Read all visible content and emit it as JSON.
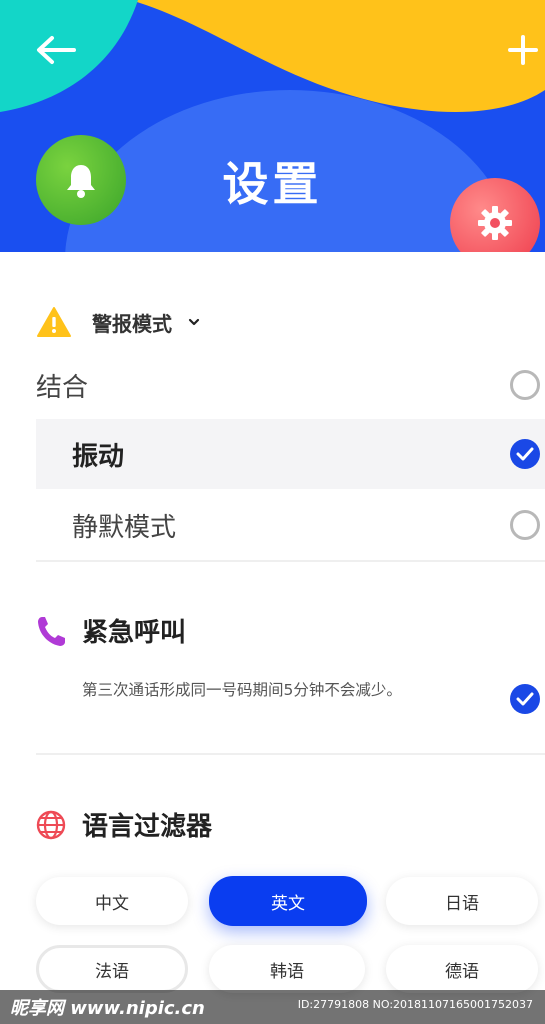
{
  "header": {
    "title": "设置",
    "back_icon": "arrow-left-icon",
    "add_icon": "plus-icon",
    "bell_icon": "bell-icon",
    "settings_icon": "gear-icon",
    "colors": {
      "teal": "#13d6c8",
      "yellow": "#ffc21a",
      "blue": "#1a4ff0",
      "green": "#4cb82f",
      "red": "#f25060"
    }
  },
  "alert_mode": {
    "icon": "warning-icon",
    "label": "警报模式",
    "dropdown_icon": "chevron-down-icon",
    "options": [
      {
        "label": "结合",
        "selected": false
      },
      {
        "label": "振动",
        "selected": true
      },
      {
        "label": "静默模式",
        "selected": false
      }
    ]
  },
  "emergency_call": {
    "icon": "phone-icon",
    "title": "紧急呼叫",
    "description": "第三次通话形成同一号码期间5分钟不会减少。",
    "checked": true
  },
  "language_filter": {
    "icon": "globe-icon",
    "title": "语言过滤器",
    "chips": [
      {
        "label": "中文",
        "active": false
      },
      {
        "label": "英文",
        "active": true
      },
      {
        "label": "日语",
        "active": false
      },
      {
        "label": "法语",
        "active": false
      },
      {
        "label": "韩语",
        "active": false
      },
      {
        "label": "德语",
        "active": false
      }
    ]
  },
  "watermark": {
    "left": "昵享网 www.nipic.cn",
    "right": "ID:27791808 NO:20181107165001752037"
  }
}
